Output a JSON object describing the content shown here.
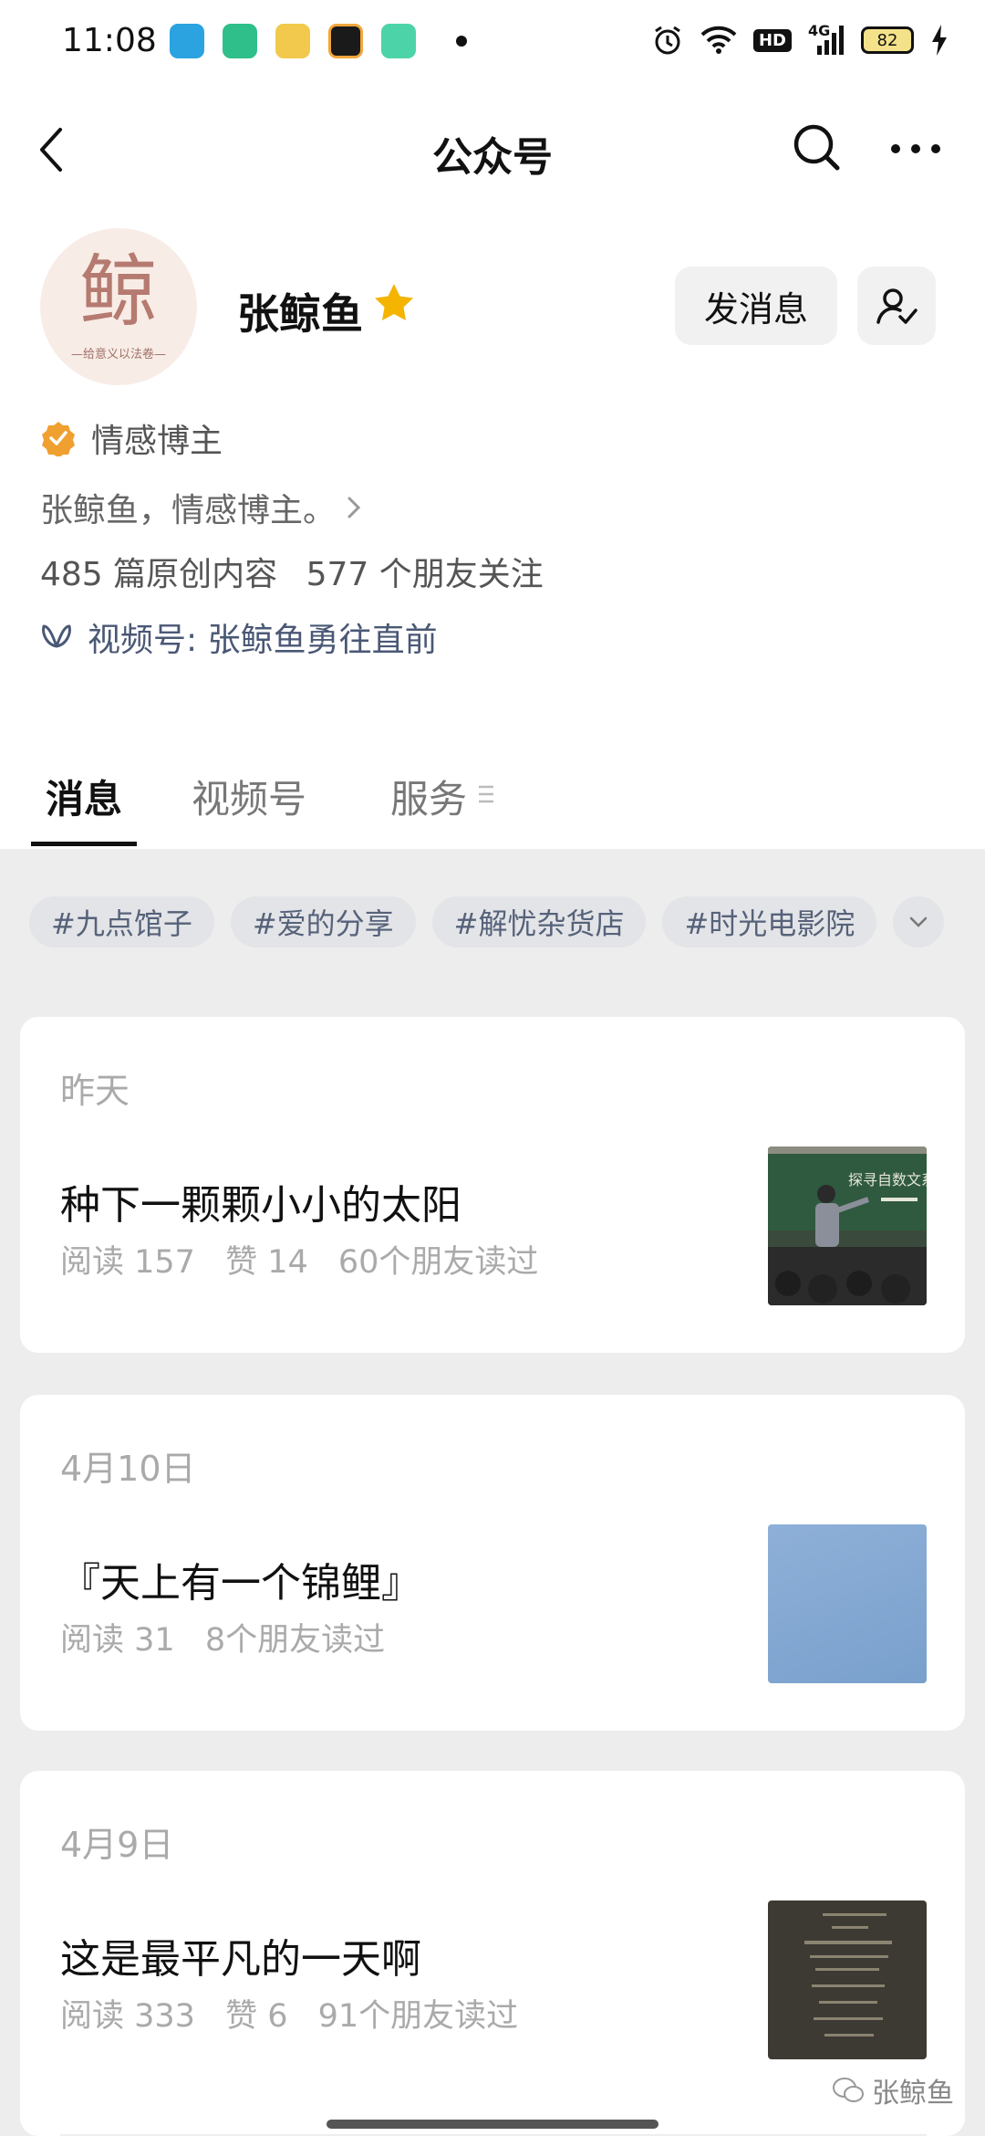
{
  "status_bar": {
    "time": "11:08",
    "network_label": "4G",
    "hd_label": "HD",
    "battery": "82"
  },
  "nav": {
    "title": "公众号"
  },
  "profile": {
    "avatar_char": "鲸",
    "avatar_subtitle": "—给意义以法卷—",
    "name": "张鲸鱼",
    "message_button": "发消息",
    "verify_label": "情感博主",
    "bio": "张鲸鱼，情感博主。",
    "stats": {
      "articles": "485 篇原创内容",
      "followers": "577 个朋友关注"
    },
    "channel_label": "视频号:  张鲸鱼勇往直前"
  },
  "tabs": [
    {
      "label": "消息",
      "active": true
    },
    {
      "label": "视频号",
      "active": false
    },
    {
      "label": "服务",
      "active": false
    }
  ],
  "tags": [
    "#九点馆子",
    "#爱的分享",
    "#解忧杂货店",
    "#时光电影院"
  ],
  "cards": [
    {
      "date": "昨天",
      "title": "种下一颗颗小小的太阳",
      "meta": [
        "阅读 157",
        "赞 14",
        "60个朋友读过"
      ],
      "thumb_text": "探寻自数文系"
    },
    {
      "date": "4月10日",
      "title": "『天上有一个锦鲤』",
      "meta": [
        "阅读 31",
        "8个朋友读过"
      ]
    },
    {
      "date": "4月9日",
      "title": "这是最平凡的一天啊",
      "meta": [
        "阅读 333",
        "赞 6",
        "91个朋友读过"
      ]
    }
  ],
  "watermark": "张鲸鱼",
  "colors": {
    "accent_star": "#f4b400",
    "verify_badge": "#f0a030",
    "tag_text": "#56627a",
    "channel_text": "#4a5875",
    "background": "#ededed"
  }
}
